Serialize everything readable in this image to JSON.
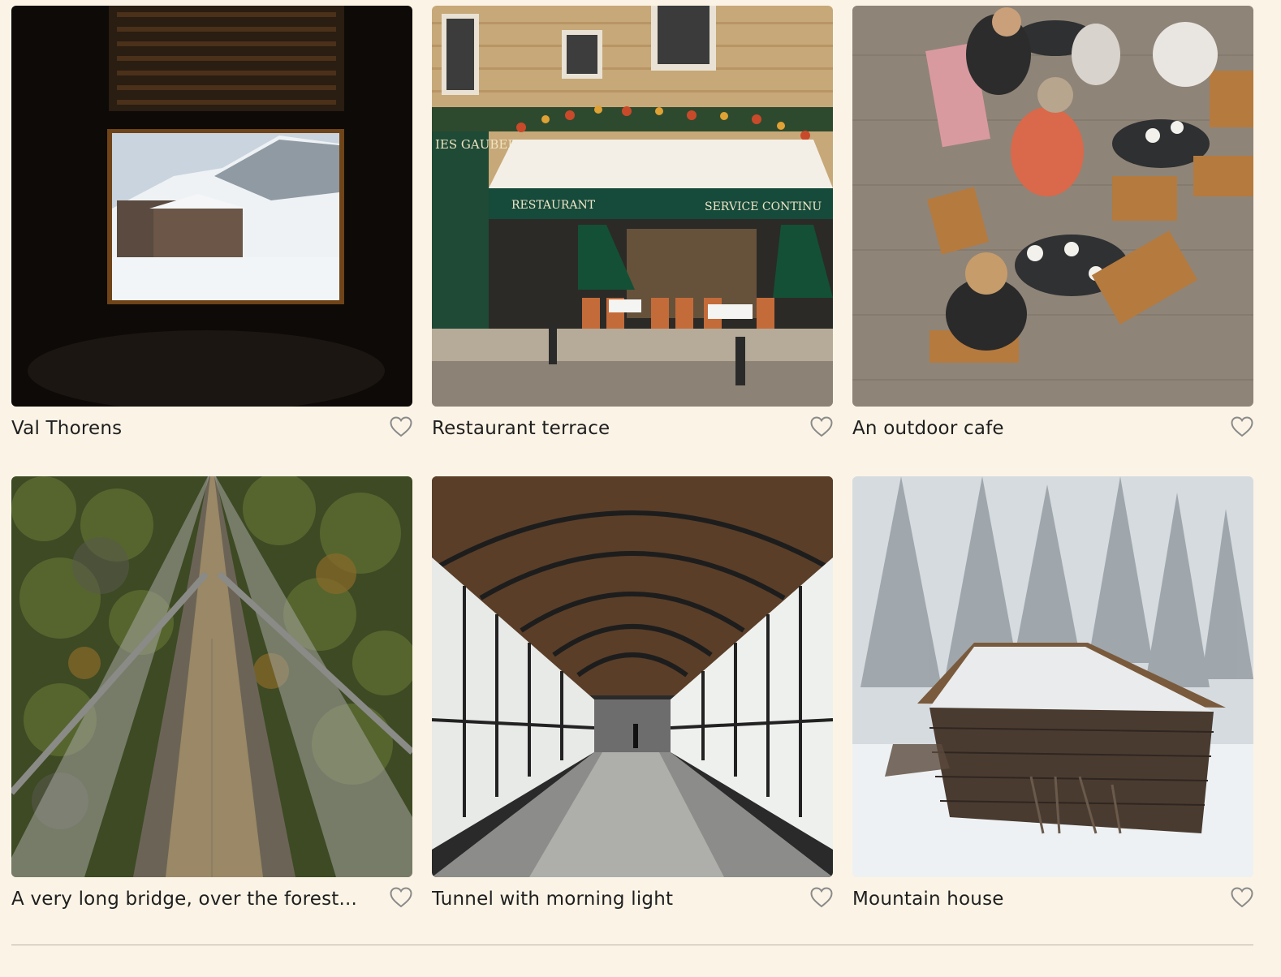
{
  "gallery": {
    "items": [
      {
        "title": "Val Thorens",
        "image_icon": "snowy-village-window-image",
        "favorite_icon": "heart-outline-icon",
        "favorited": false
      },
      {
        "title": "Restaurant terrace",
        "image_icon": "restaurant-facade-image",
        "favorite_icon": "heart-outline-icon",
        "favorited": false
      },
      {
        "title": "An outdoor cafe",
        "image_icon": "cafe-tables-image",
        "favorite_icon": "heart-outline-icon",
        "favorited": false
      },
      {
        "title": "A very long bridge, over the forest...",
        "image_icon": "suspension-bridge-image",
        "favorite_icon": "heart-outline-icon",
        "favorited": false
      },
      {
        "title": "Tunnel with morning light",
        "image_icon": "glass-tunnel-image",
        "favorite_icon": "heart-outline-icon",
        "favorited": false
      },
      {
        "title": "Mountain house",
        "image_icon": "snowy-cabin-image",
        "favorite_icon": "heart-outline-icon",
        "favorited": false
      }
    ],
    "photo_signs": {
      "restaurant_awning_left": "RESTAURANT",
      "restaurant_awning_right": "SERVICE CONTINU",
      "restaurant_shop_sign": "IES GAUBERT"
    }
  },
  "colors": {
    "background": "#FBF4E6",
    "text": "#1F1F1F",
    "heart_outline": "#8A8A8A",
    "divider": "#B8B2A6"
  }
}
